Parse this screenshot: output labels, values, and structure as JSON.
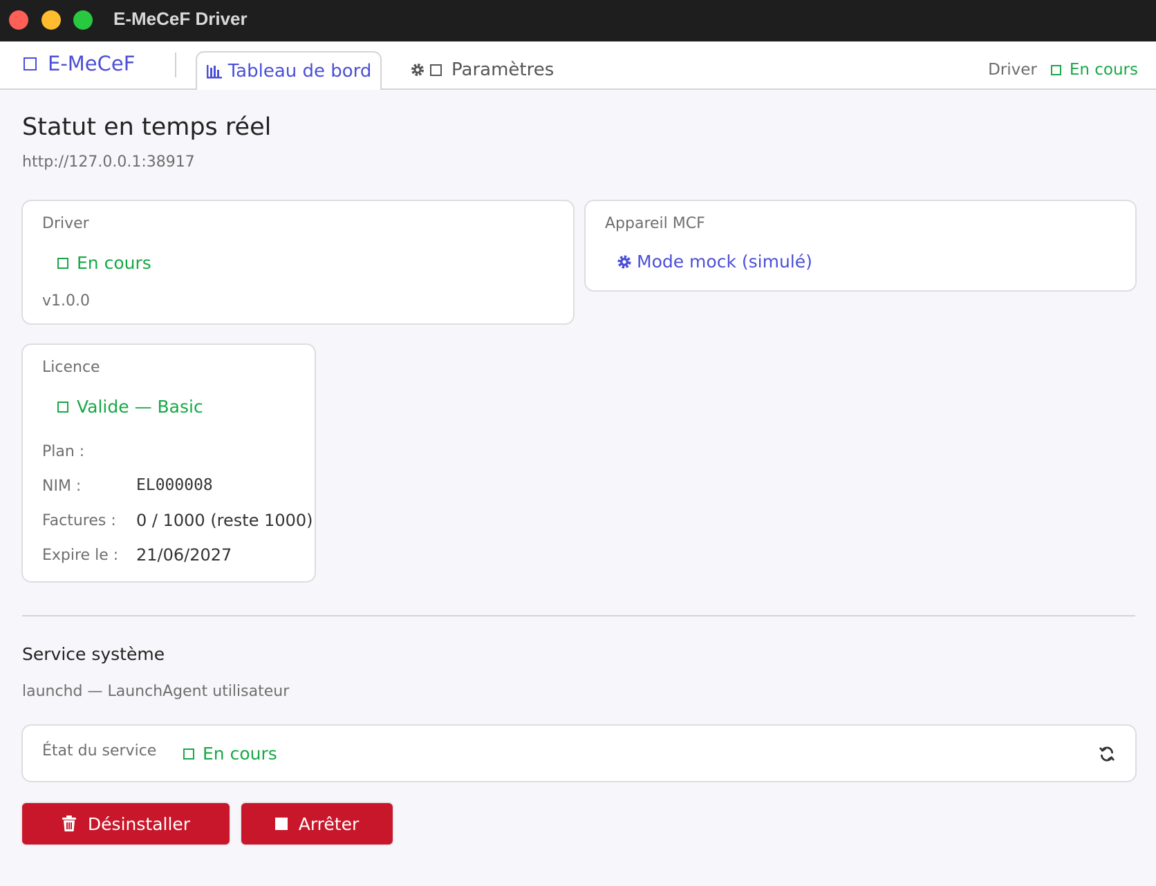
{
  "window": {
    "title": "E-MeCeF Driver"
  },
  "nav": {
    "brand": "E-MeCeF",
    "tabs": [
      {
        "label": "Tableau de bord",
        "active": true,
        "icon": "bar-chart-icon"
      },
      {
        "label": "Paramètres",
        "active": false,
        "icon": "gear-icon"
      }
    ],
    "status_label": "Driver",
    "status_value": "En cours"
  },
  "page": {
    "title": "Statut en temps réel",
    "url": "http://127.0.0.1:38917"
  },
  "driver_card": {
    "label": "Driver",
    "status": "En cours",
    "version": "v1.0.0"
  },
  "device_card": {
    "label": "Appareil MCF",
    "mode": "Mode mock (simulé)",
    "icon": "gear-icon"
  },
  "license_card": {
    "label": "Licence",
    "status": "Valide — Basic",
    "rows": [
      {
        "label": "Plan :",
        "value": ""
      },
      {
        "label": "NIM :",
        "value": "EL000008"
      },
      {
        "label": "Factures :",
        "value": "0 / 1000 (reste 1000)"
      },
      {
        "label": "Expire le :",
        "value": "21/06/2027"
      }
    ]
  },
  "service": {
    "title": "Service système",
    "subtitle": "launchd — LaunchAgent utilisateur",
    "state_label": "État du service",
    "state_value": "En cours",
    "uninstall_label": "Désinstaller",
    "stop_label": "Arrêter"
  },
  "colors": {
    "accent": "#4b4fd6",
    "success": "#17a845",
    "danger": "#c8172b",
    "titlebar": "#1e1e1e"
  }
}
